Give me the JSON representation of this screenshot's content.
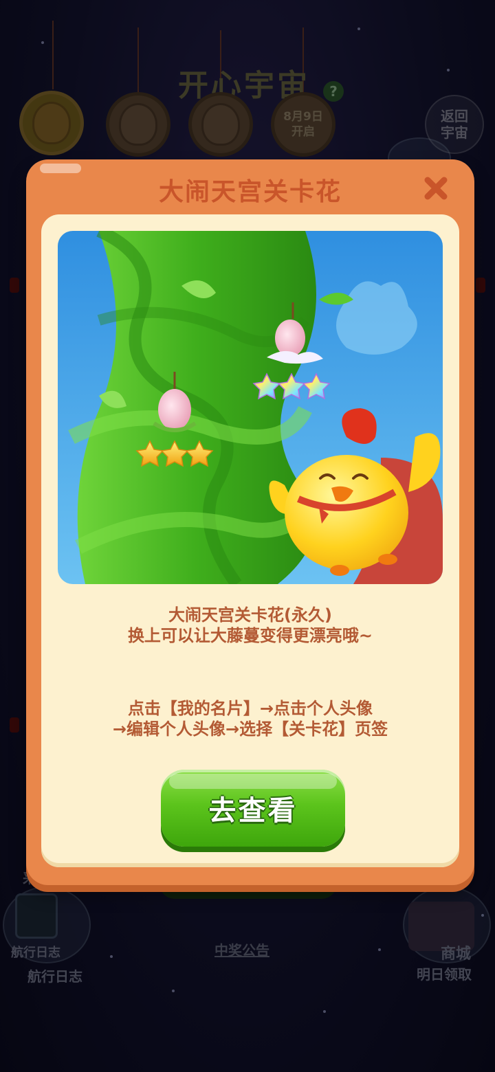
{
  "background": {
    "game_title": "开心宇宙",
    "help_icon": "question-icon",
    "medals": [
      {
        "kind": "monkey-king-avatar"
      },
      {
        "kind": "character-avatar"
      },
      {
        "kind": "character-avatar"
      },
      {
        "kind": "date",
        "date_line1": "8月9日",
        "date_line2": "开启"
      }
    ],
    "return_button": "返回宇宙",
    "log_icon_label": "航行日志",
    "log_label": "航行日志",
    "notice_link": "中奖公告",
    "shop_icon_label": "商城",
    "shop_label": "明日领取",
    "partial_left_label": "采"
  },
  "dialog": {
    "title": "大闹天宫关卡花",
    "close_icon": "close-icon",
    "illustration": {
      "subject": "beanstalk-with-peach-flowers-and-chick",
      "left_flower_stars": 3,
      "right_flower_stars": 3
    },
    "desc_line1": "大闹天宫关卡花(永久)",
    "desc_line2": "换上可以让大藤蔓变得更漂亮哦~",
    "hint_line1": "点击【我的名片】→点击个人头像",
    "hint_line2": "→编辑个人头像→选择【关卡花】页签",
    "action_button": "去查看"
  },
  "colors": {
    "dialog_frame": "#e9874b",
    "dialog_inner": "#fdf1cf",
    "title_text": "#c9552a",
    "body_text": "#b35a34",
    "button_green": "#5cc41c"
  }
}
